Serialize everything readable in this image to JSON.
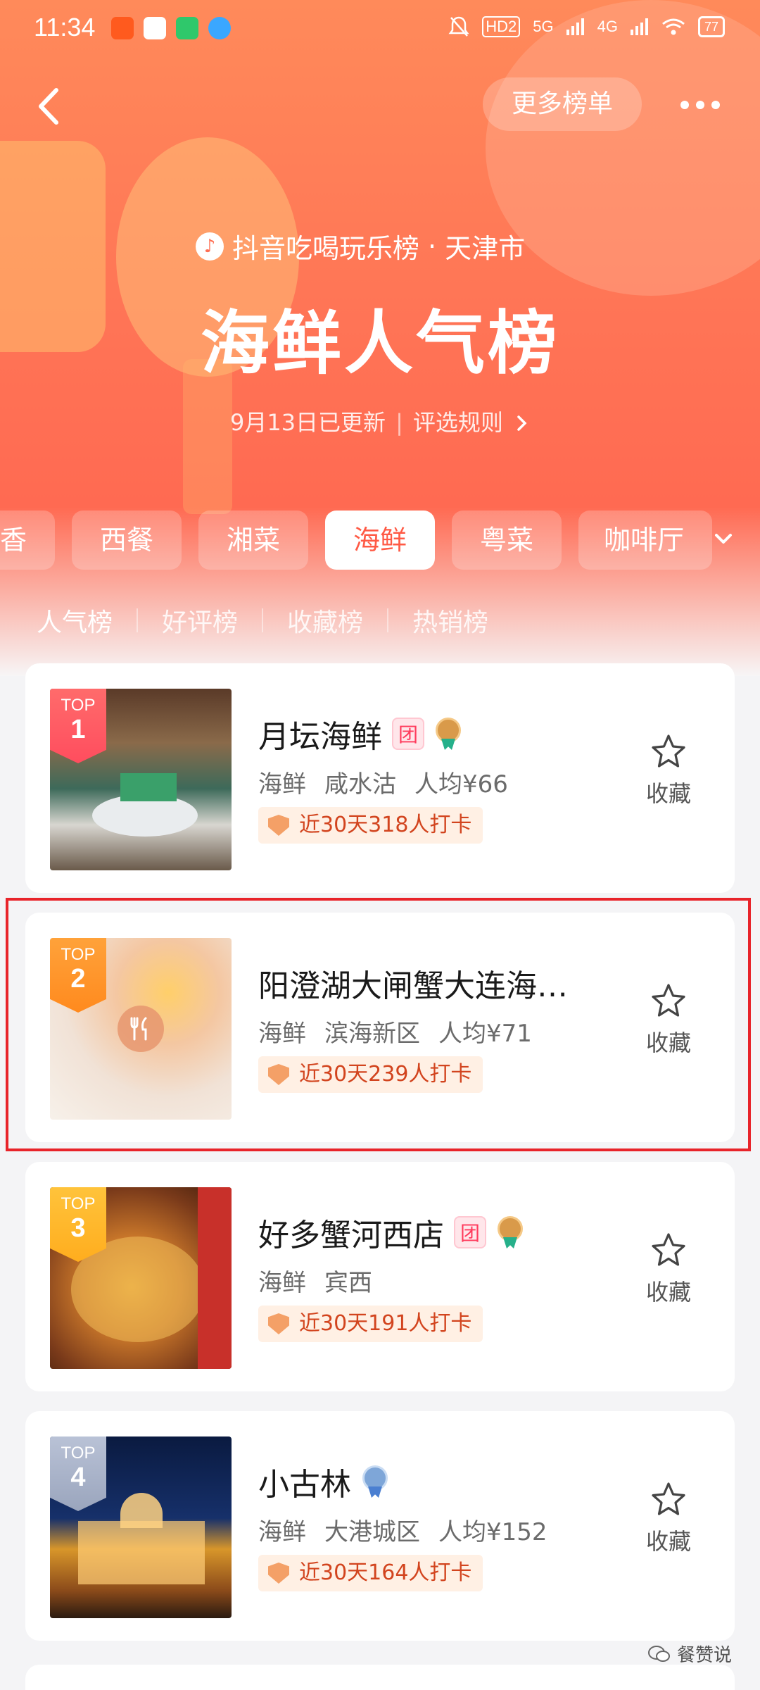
{
  "status_bar": {
    "time": "11:34",
    "hd_label": "HD2",
    "net_5g": "5G",
    "net_4g": "4G",
    "battery": "77"
  },
  "header": {
    "more_lists_label": "更多榜单"
  },
  "banner": {
    "brand": "抖音吃喝玩乐榜",
    "separator": "·",
    "city": "天津市",
    "title": "海鲜人气榜",
    "updated": "9月13日已更新",
    "rules_label": "评选规则"
  },
  "categories": [
    "香",
    "西餐",
    "湘菜",
    "海鲜",
    "粤菜",
    "咖啡厅"
  ],
  "active_category": "海鲜",
  "sub_tabs": [
    "人气榜",
    "好评榜",
    "收藏榜",
    "热销榜"
  ],
  "active_sub_tab": "人气榜",
  "ranking": [
    {
      "rank_label": "TOP",
      "rank": "1",
      "name": "月坛海鲜",
      "tuan": "团",
      "meta": [
        "海鲜",
        "咸水沽",
        "人均¥66"
      ],
      "checkin": "近30天318人打卡",
      "fav_label": "收藏",
      "medal": "gold"
    },
    {
      "rank_label": "TOP",
      "rank": "2",
      "name": "阳澄湖大闸蟹大连海…",
      "meta": [
        "海鲜",
        "滨海新区",
        "人均¥71"
      ],
      "checkin": "近30天239人打卡",
      "fav_label": "收藏"
    },
    {
      "rank_label": "TOP",
      "rank": "3",
      "name": "好多蟹河西店",
      "tuan": "团",
      "meta": [
        "海鲜",
        "宾西"
      ],
      "checkin": "近30天191人打卡",
      "fav_label": "收藏",
      "medal": "gold"
    },
    {
      "rank_label": "TOP",
      "rank": "4",
      "name": "小古林",
      "meta": [
        "海鲜",
        "大港城区",
        "人均¥152"
      ],
      "checkin": "近30天164人打卡",
      "fav_label": "收藏",
      "medal": "blue"
    }
  ],
  "watermark": "餐赞说",
  "colors": {
    "accent": "#ff5a45",
    "highlight_border": "#e8242a",
    "checkin_text": "#d2441e"
  }
}
